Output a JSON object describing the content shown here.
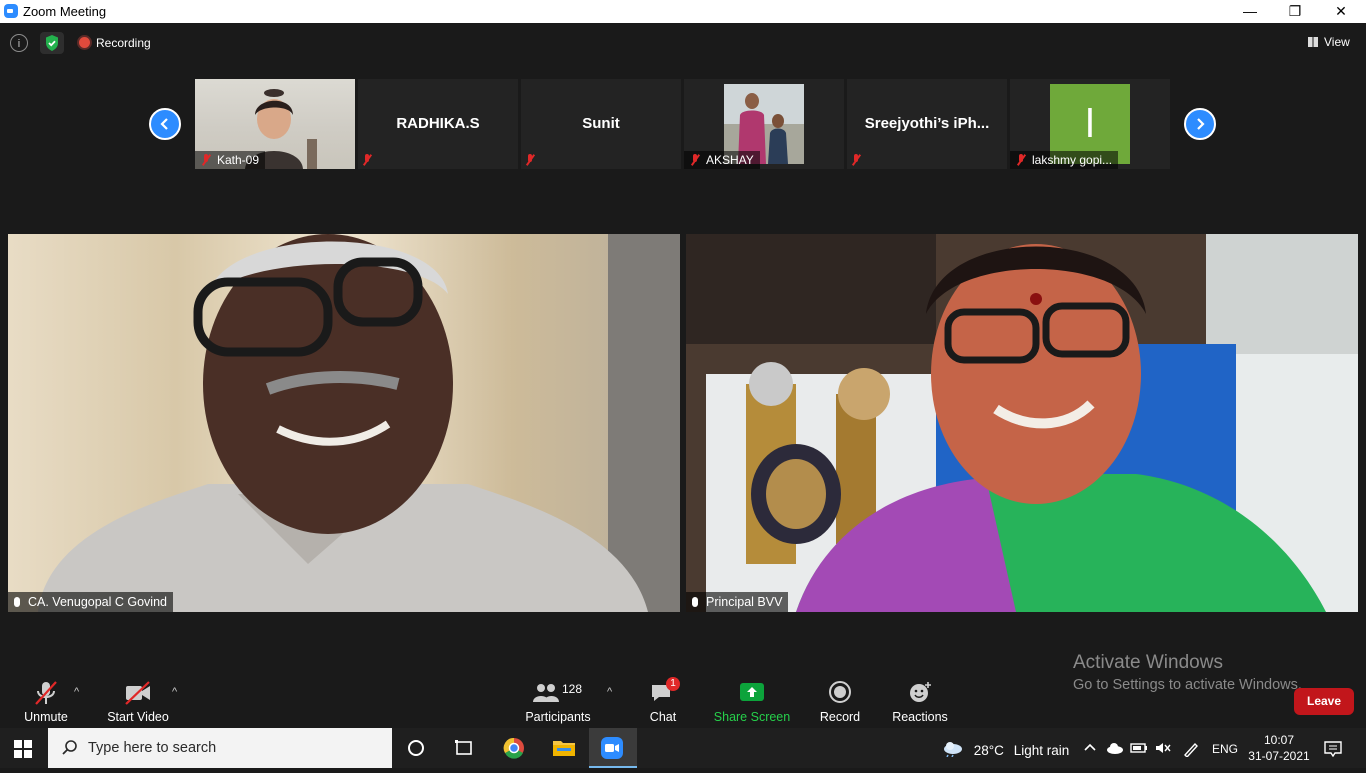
{
  "window": {
    "title": "Zoom Meeting",
    "controls": [
      "—",
      "❐",
      "✕"
    ]
  },
  "topbar": {
    "info_symbol": "i",
    "recording_label": "Recording",
    "view_label": "View"
  },
  "thumbnails": [
    {
      "label": "Kath-09",
      "has_video": true
    },
    {
      "center_name": "RADHIKA.S",
      "has_video": false
    },
    {
      "center_name": "Sunit",
      "has_video": false
    },
    {
      "label": "AKSHAY",
      "has_video": true
    },
    {
      "center_name": "Sreejyothi’s  iPh...",
      "has_video": false
    },
    {
      "label": "lakshmy gopi...",
      "avatar_letter": "l",
      "has_video": false
    }
  ],
  "speakers": [
    {
      "label": "CA. Venugopal C Govind"
    },
    {
      "label": "Principal BVV"
    }
  ],
  "activation": {
    "line1": "Activate Windows",
    "line2": "Go to Settings to activate Windows."
  },
  "toolbar": {
    "unmute_label": "Unmute",
    "start_video_label": "Start Video",
    "participants_count": "128",
    "participants_label": "Participants",
    "chat_badge": "1",
    "chat_label": "Chat",
    "share_label": "Share Screen",
    "record_label": "Record",
    "reactions_label": "Reactions",
    "leave_label": "Leave",
    "caret": "^"
  },
  "taskbar": {
    "search_placeholder": "Type here to search",
    "weather_temp": "28°C",
    "weather_text": "Light rain",
    "language": "ENG",
    "time": "10:07",
    "date": "31-07-2021"
  },
  "colors": {
    "zoom_blue": "#2D8CFF",
    "leave_red": "#C2161B",
    "share_green": "#0CA33B",
    "share_label": "#26D04B",
    "chat_badge_red": "#E02828"
  }
}
